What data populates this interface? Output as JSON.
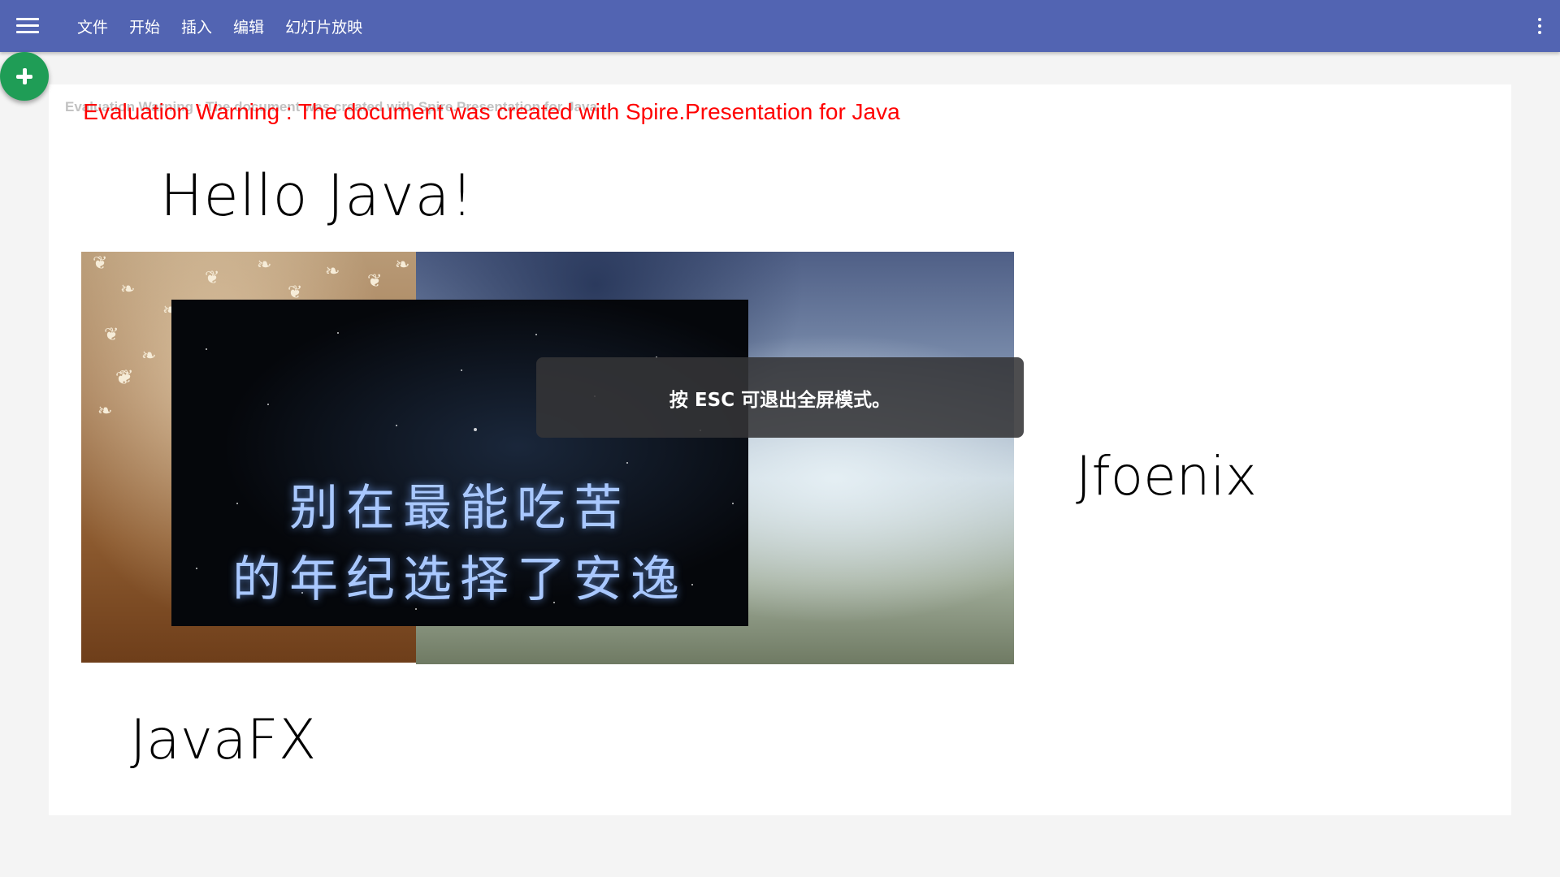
{
  "appbar": {
    "menu_icon": "hamburger-menu-icon",
    "menu": [
      "文件",
      "开始",
      "插入",
      "编辑",
      "幻灯片放映"
    ],
    "more_icon": "more-vert-icon",
    "color": "#5264b2"
  },
  "fab": {
    "icon": "plus-icon",
    "color": "#1f9d56"
  },
  "slide": {
    "eval_warning_small": "Evaluation Warning : The document was created with  Spire.Presentation for Java",
    "eval_warning_big": "Evaluation Warning : The document was created with  Spire.Presentation for Java",
    "title_hello": "Hello Java!",
    "title_jfoenix": "Jfoenix",
    "title_javafx": "JavaFX",
    "poem_line_1": "别在最能吃苦",
    "poem_line_2": "的年纪选择了安逸"
  },
  "toast": {
    "text": "按 ESC 可退出全屏模式。"
  }
}
